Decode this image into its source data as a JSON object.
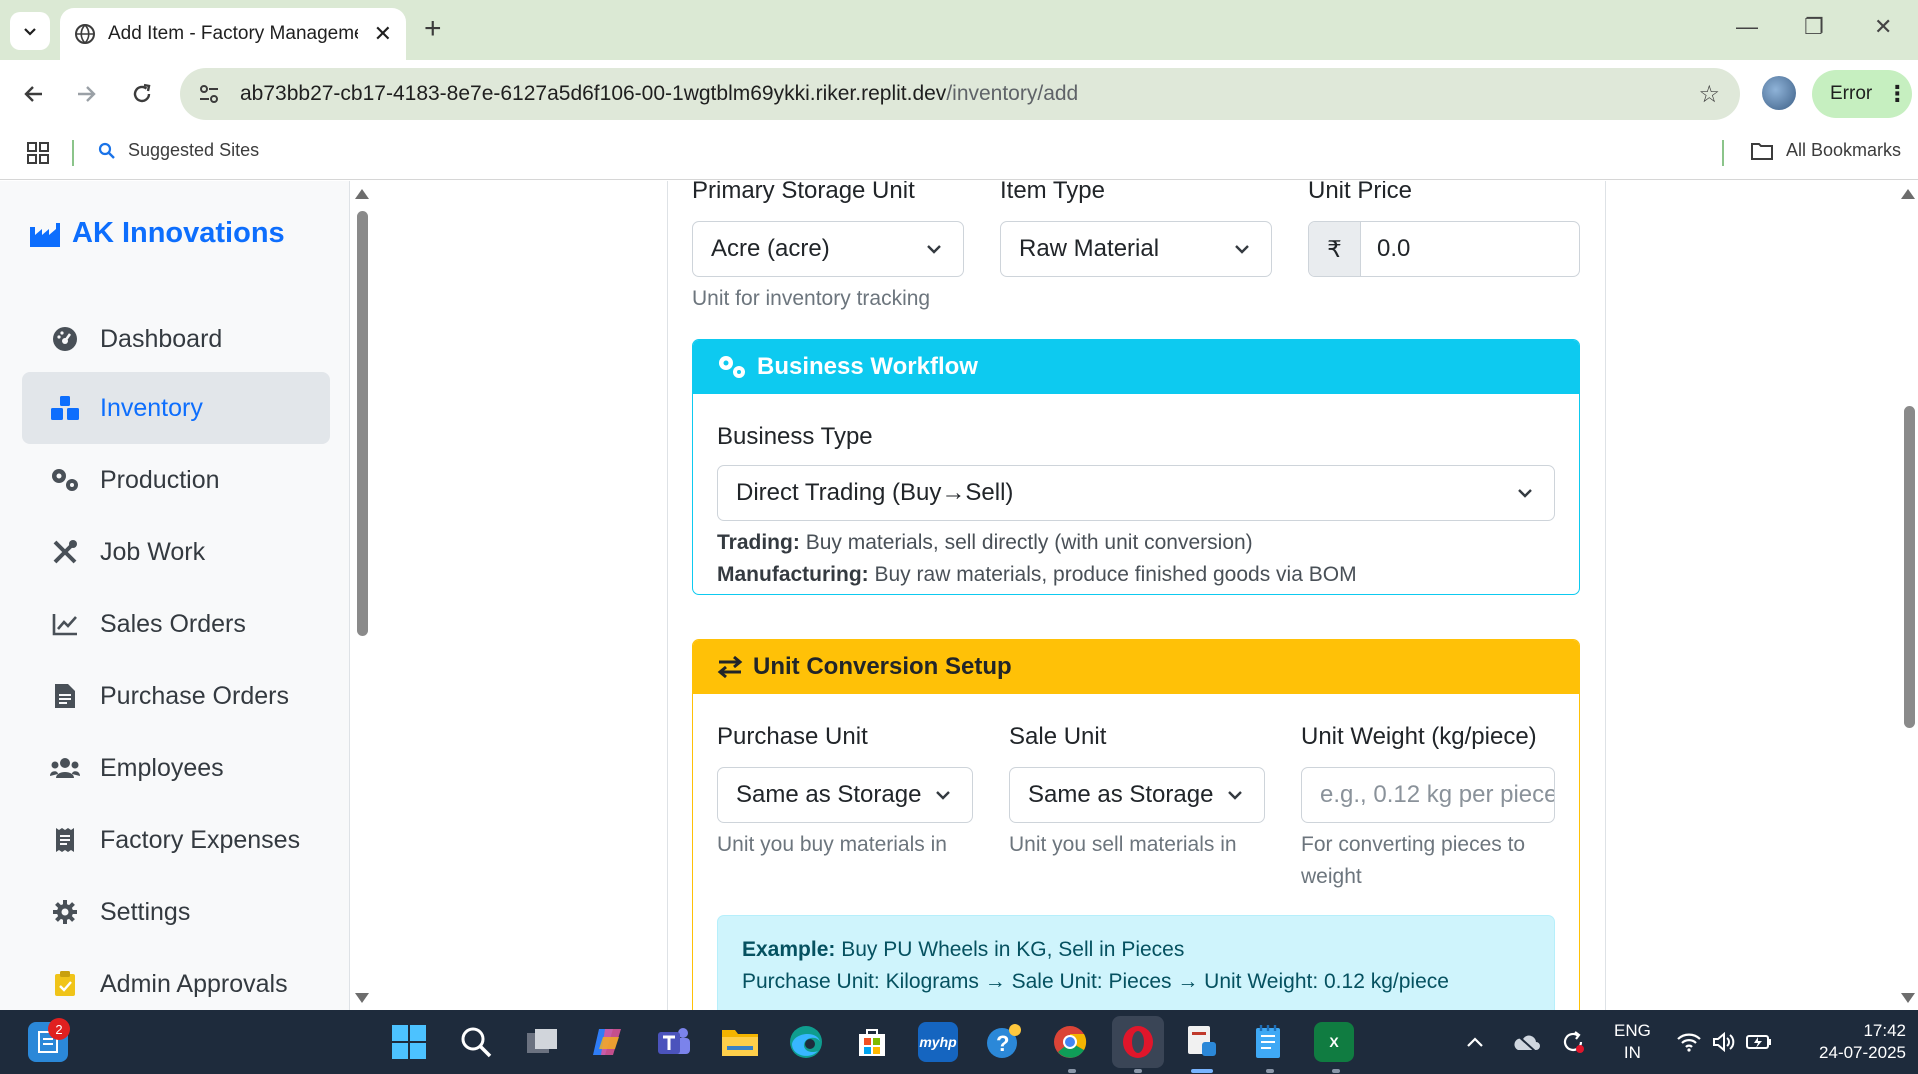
{
  "browser": {
    "tab_title": "Add Item - Factory Managemen",
    "url_host": "ab73bb27-cb17-4183-8e7e-6127a5d6f106-00-1wgtblm69ykki.riker.replit.dev",
    "url_path": "/inventory/add",
    "profile_status": "Error",
    "bookmarks": {
      "suggested": "Suggested Sites",
      "all": "All Bookmarks"
    }
  },
  "sidebar": {
    "brand": "AK Innovations",
    "items": [
      {
        "label": "Dashboard",
        "icon": "dashboard-icon",
        "active": false
      },
      {
        "label": "Inventory",
        "icon": "boxes-icon",
        "active": true
      },
      {
        "label": "Production",
        "icon": "cogs-icon",
        "active": false
      },
      {
        "label": "Job Work",
        "icon": "tools-icon",
        "active": false
      },
      {
        "label": "Sales Orders",
        "icon": "chart-line-icon",
        "active": false
      },
      {
        "label": "Purchase Orders",
        "icon": "file-invoice-icon",
        "active": false
      },
      {
        "label": "Employees",
        "icon": "users-icon",
        "active": false
      },
      {
        "label": "Factory Expenses",
        "icon": "receipt-icon",
        "active": false
      },
      {
        "label": "Settings",
        "icon": "gear-icon",
        "active": false
      },
      {
        "label": "Admin Approvals",
        "icon": "clipboard-check-icon",
        "active": false
      }
    ]
  },
  "form": {
    "storage_unit": {
      "label": "Primary Storage Unit",
      "value": "Acre (acre)",
      "hint": "Unit for inventory tracking"
    },
    "item_type": {
      "label": "Item Type",
      "value": "Raw Material"
    },
    "unit_price": {
      "label": "Unit Price",
      "currency": "₹",
      "value": "0.0"
    },
    "workflow": {
      "title": "Business Workflow",
      "business_type_label": "Business Type",
      "business_type_value": "Direct Trading (Buy→Sell)",
      "trading_term": "Trading:",
      "trading_desc": "Buy materials, sell directly (with unit conversion)",
      "manufacturing_term": "Manufacturing:",
      "manufacturing_desc": "Buy raw materials, produce finished goods via BOM"
    },
    "conversion": {
      "title": "Unit Conversion Setup",
      "purchase_unit": {
        "label": "Purchase Unit",
        "value": "Same as Storage",
        "hint": "Unit you buy materials in"
      },
      "sale_unit": {
        "label": "Sale Unit",
        "value": "Same as Storage",
        "hint": "Unit you sell materials in"
      },
      "unit_weight": {
        "label": "Unit Weight (kg/piece)",
        "placeholder": "e.g., 0.12 kg per piece",
        "hint_line1": "For converting pieces to",
        "hint_line2": "weight"
      },
      "example_term": "Example:",
      "example_text": "Buy PU Wheels in KG, Sell in Pieces",
      "example_line2": "Purchase Unit: Kilograms → Sale Unit: Pieces → Unit Weight: 0.12 kg/piece"
    }
  },
  "taskbar": {
    "notification_count": "2",
    "lang_line1": "ENG",
    "lang_line2": "IN",
    "time": "17:42",
    "date": "24-07-2025",
    "apps": [
      "start-icon",
      "search-icon",
      "task-view-icon",
      "copilot-icon",
      "teams-icon",
      "file-explorer-icon",
      "edge-icon",
      "store-icon",
      "myhp-icon",
      "help-icon",
      "chrome-icon",
      "opera-icon",
      "app-icon",
      "notepad-icon",
      "excel-icon"
    ],
    "myhp_label": "myhp",
    "excel_label": "X"
  },
  "colors": {
    "brand": "#0d6efd",
    "info": "#0dcaf0",
    "warning": "#ffc107",
    "alert_bg": "#cff4fc"
  }
}
